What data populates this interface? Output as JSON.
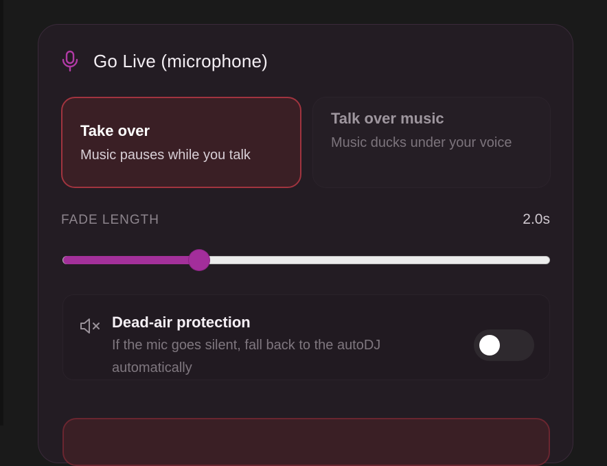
{
  "colors": {
    "accent": "#a3309a",
    "active_border": "#a1343f",
    "card_bg": "#231c23"
  },
  "header": {
    "icon": "microphone-icon",
    "title": "Go Live (microphone)"
  },
  "modes": [
    {
      "title": "Take over",
      "subtitle": "Music pauses while you talk",
      "selected": true
    },
    {
      "title": "Talk over music",
      "subtitle": "Music ducks under your voice",
      "selected": false
    }
  ],
  "fade": {
    "label": "FADE LENGTH",
    "value_text": "2.0s",
    "fraction": 0.28
  },
  "dead_air": {
    "icon": "speaker-muted-icon",
    "title": "Dead-air protection",
    "subtitle": "If the mic goes silent, fall back to the autoDJ automatically",
    "enabled": false
  }
}
